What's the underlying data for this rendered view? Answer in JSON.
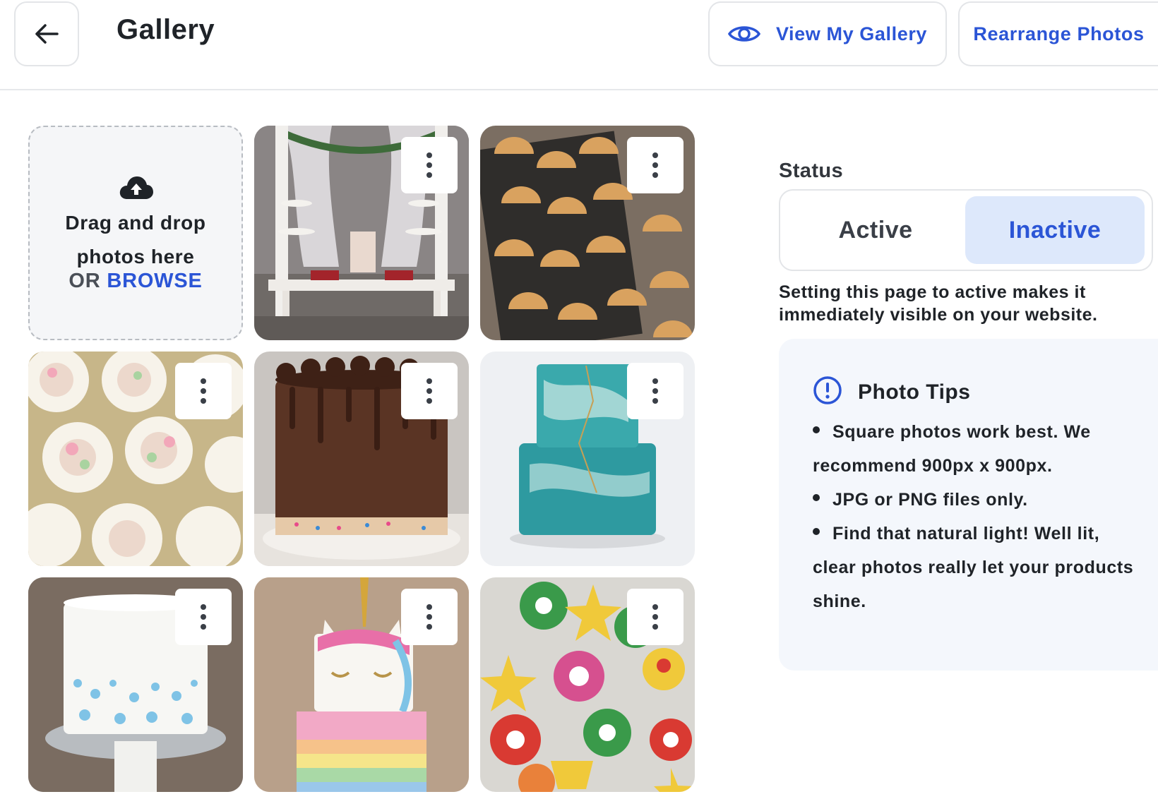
{
  "header": {
    "title": "Gallery",
    "view_gallery_label": "View My Gallery",
    "rearrange_label": "Rearrange Photos"
  },
  "upload": {
    "line1": "Drag and drop",
    "line2": "photos here",
    "or_label": "OR",
    "browse_label": "BROWSE"
  },
  "photos": [
    {
      "subject": "dessert table with cake and cupcake stands"
    },
    {
      "subject": "heart hand pies on cooling rack"
    },
    {
      "subject": "floral frosted cupcakes"
    },
    {
      "subject": "chocolate drip cake with sprinkles"
    },
    {
      "subject": "teal marble two-tier cake"
    },
    {
      "subject": "white cake with blue sprinkles"
    },
    {
      "subject": "unicorn rainbow cake"
    },
    {
      "subject": "mario themed cookies"
    }
  ],
  "status": {
    "label": "Status",
    "options": [
      "Active",
      "Inactive"
    ],
    "selected": "Inactive",
    "help": "Setting this page to active makes it immediately visible on your website."
  },
  "tips": {
    "title": "Photo Tips",
    "items": [
      "Square photos work best. We recommend 900px x 900px.",
      "JPG or PNG files only.",
      "Find that natural light! Well lit, clear photos really let your products shine."
    ]
  },
  "colors": {
    "accent": "#2b55d6",
    "selected_bg": "#dde8fb",
    "tips_bg": "#f4f7fc"
  }
}
